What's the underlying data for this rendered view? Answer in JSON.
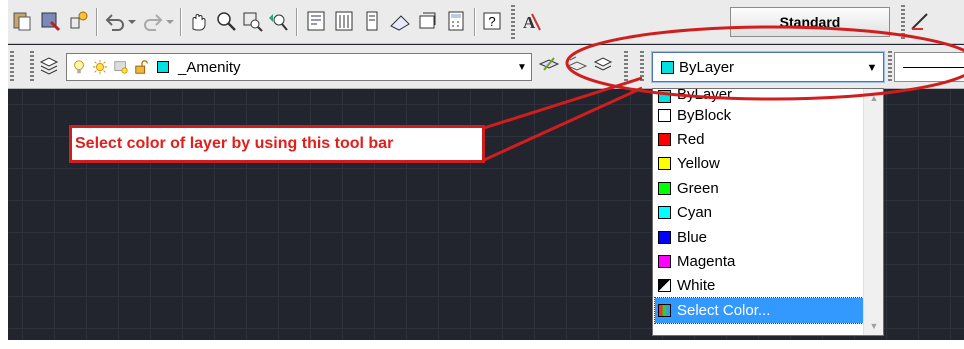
{
  "toolbar_standard": {
    "text_style": "Standard"
  },
  "toolbar_layers": {
    "current_layer": "_Amenity",
    "color_value": "ByLayer",
    "color_swatch": "#00e0e0"
  },
  "color_list": [
    {
      "label": "ByLayer",
      "swatch": "#00e0e0"
    },
    {
      "label": "ByBlock",
      "swatch": "#ffffff"
    },
    {
      "label": "Red",
      "swatch": "#ff0000"
    },
    {
      "label": "Yellow",
      "swatch": "#ffff00"
    },
    {
      "label": "Green",
      "swatch": "#00ff00"
    },
    {
      "label": "Cyan",
      "swatch": "#00ffff"
    },
    {
      "label": "Blue",
      "swatch": "#0000ff"
    },
    {
      "label": "Magenta",
      "swatch": "#ff00ff"
    },
    {
      "label": "White",
      "swatch": "half-black-white"
    },
    {
      "label": "Select Color...",
      "swatch": "palette"
    }
  ],
  "annotation": {
    "text": "Select color of layer by using this tool bar",
    "color": "#e0201c"
  }
}
